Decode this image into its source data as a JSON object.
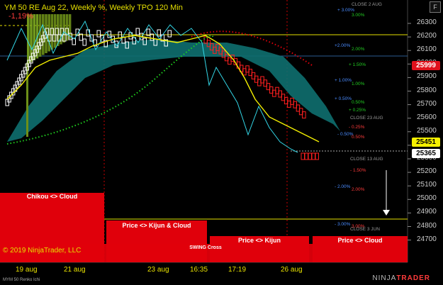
{
  "header": {
    "title": "YM 50 RE Aug 22, Weekly %, Weekly TPO 120 Min",
    "change_pct": "-1,19%"
  },
  "corner_button": "F",
  "price_axis": [
    "26300",
    "26200",
    "26100",
    "26000",
    "25900",
    "25800",
    "25700",
    "25600",
    "25500",
    "25400",
    "25300",
    "25200",
    "25100",
    "25000",
    "24900",
    "24800",
    "24700"
  ],
  "price_tags": [
    {
      "value": "25999",
      "bg": "#e0111c",
      "fg": "#ffffff"
    },
    {
      "value": "25451",
      "bg": "#f4f000",
      "fg": "#000000"
    },
    {
      "value": "25365",
      "bg": "#ffffff",
      "fg": "#000000"
    }
  ],
  "x_axis": [
    "19 aug",
    "21 aug",
    "23 aug",
    "16:35",
    "17:19",
    "26 aug"
  ],
  "panels": {
    "chikou": "Chikou <> Cloud",
    "kijun_cloud": "Price <> Kijun & Cloud",
    "swing": "SWING Cross",
    "kijun": "Price <> Kijun",
    "cloud": "Price <> Cloud"
  },
  "level_labels": [
    {
      "text": "CLOSE 2 AUG",
      "color": "#9a9a9a"
    },
    {
      "text": "+ 3.00%",
      "color": "#4a8cff"
    },
    {
      "text": "3.00%",
      "color": "#22cc22"
    },
    {
      "text": "+2.00%",
      "color": "#4a8cff"
    },
    {
      "text": "2.00%",
      "color": "#22cc22"
    },
    {
      "text": "+ 1.50%",
      "color": "#22cc22"
    },
    {
      "text": "+ 1.00%",
      "color": "#4a8cff"
    },
    {
      "text": "1.00%",
      "color": "#22cc22"
    },
    {
      "text": "+ 0.50%",
      "color": "#4a8cff"
    },
    {
      "text": "0.50%",
      "color": "#22cc22"
    },
    {
      "text": "+ 0.25%",
      "color": "#22cc22"
    },
    {
      "text": "CLOSE 23 AUG",
      "color": "#9a9a9a"
    },
    {
      "text": "- 0.25%",
      "color": "#ff3b3b"
    },
    {
      "text": "- 0.50%",
      "color": "#4a8cff"
    },
    {
      "text": "0.50%",
      "color": "#ff3b3b"
    },
    {
      "text": "CLOSE 13 AUG",
      "color": "#9a9a9a"
    },
    {
      "text": "- 1.50%",
      "color": "#ff3b3b"
    },
    {
      "text": "- 2.00%",
      "color": "#4a8cff"
    },
    {
      "text": "2.00%",
      "color": "#ff3b3b"
    },
    {
      "text": "- 3.00%",
      "color": "#4a8cff"
    },
    {
      "text": "3.00%",
      "color": "#ff3b3b"
    },
    {
      "text": "CLOSE 3 JUN",
      "color": "#9a9a9a"
    }
  ],
  "copyright": "© 2019 NinjaTrader, LLC",
  "footer": "MYM 50 Renko Ichi",
  "brand": {
    "prefix": "NINJA",
    "suffix": "TRADER"
  },
  "colors": {
    "up": "#ffffff",
    "down": "#ff2020",
    "kijun": "#f4f000",
    "tenkan": "#33d6e6",
    "cloud": "#0e6f6f",
    "signal": "#e0000b"
  }
}
